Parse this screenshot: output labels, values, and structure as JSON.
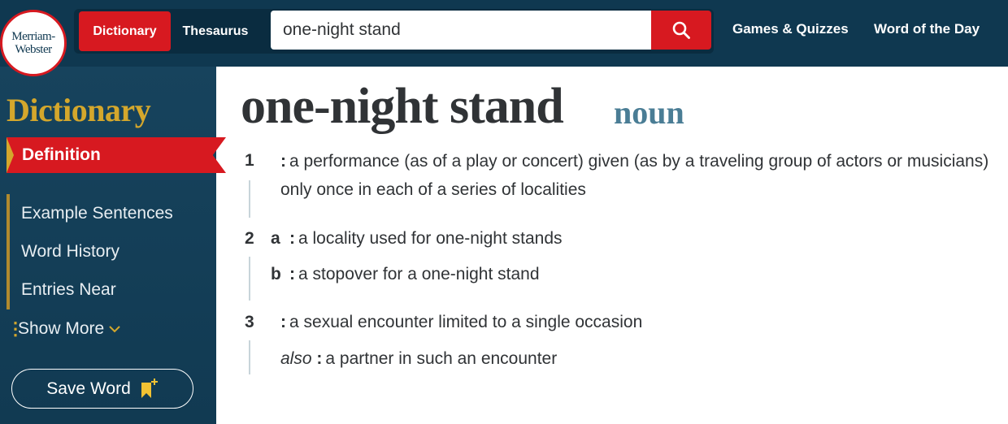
{
  "header": {
    "logo_line1": "Merriam-",
    "logo_line2": "Webster",
    "tabs": [
      {
        "label": "Dictionary",
        "active": true
      },
      {
        "label": "Thesaurus",
        "active": false
      }
    ],
    "search": {
      "value": "one-night stand"
    },
    "nav": [
      {
        "label": "Games & Quizzes"
      },
      {
        "label": "Word of the Day"
      }
    ],
    "accent_color": "#d71920",
    "bar_color": "#0f3850"
  },
  "sidebar": {
    "title": "Dictionary",
    "active_item": "Definition",
    "items": [
      {
        "label": "Example Sentences"
      },
      {
        "label": "Word History"
      },
      {
        "label": "Entries Near"
      }
    ],
    "show_more": "Show More",
    "save_word": "Save Word",
    "title_color": "#d4a72c"
  },
  "entry": {
    "headword": "one-night stand",
    "part_of_speech": "noun",
    "senses": [
      {
        "number": "1",
        "text": "a performance (as of a play or concert) given (as by a traveling group of actors or musicians) only once in each of a series of localities"
      },
      {
        "number": "2",
        "subsenses": [
          {
            "letter": "a",
            "text": "a locality used for one-night stands"
          },
          {
            "letter": "b",
            "text": "a stopover for a one-night stand"
          }
        ]
      },
      {
        "number": "3",
        "text": "a sexual encounter limited to a single occasion",
        "also_label": "also",
        "also_text": "a partner in such an encounter"
      }
    ]
  }
}
